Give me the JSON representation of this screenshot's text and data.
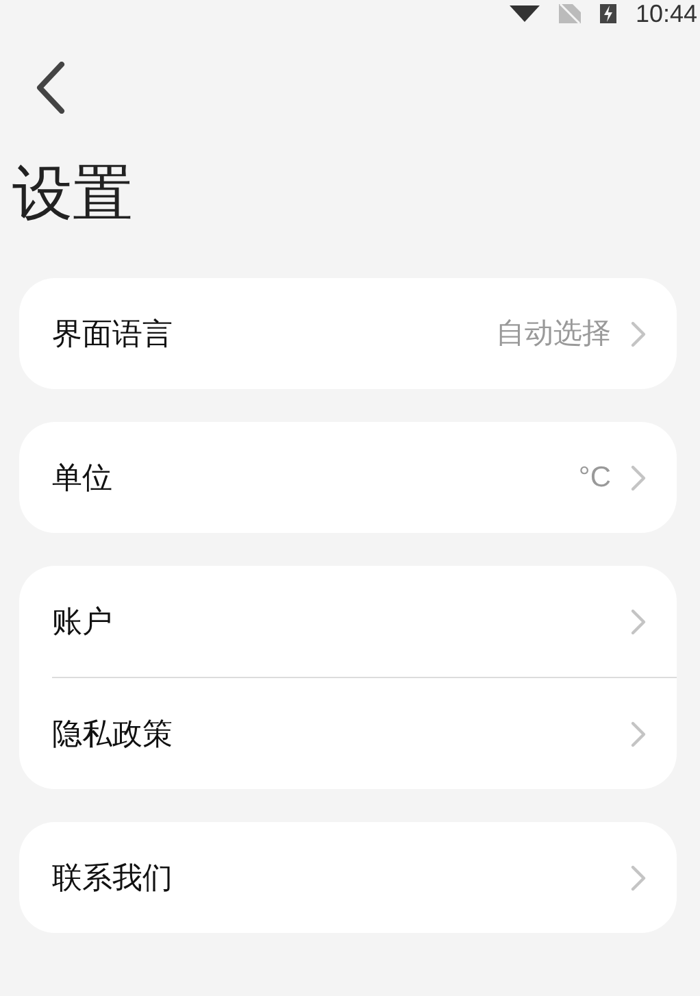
{
  "status_bar": {
    "time": "10:44"
  },
  "title": "设置",
  "groups": [
    {
      "items": [
        {
          "label": "界面语言",
          "value": "自动选择"
        }
      ]
    },
    {
      "items": [
        {
          "label": "单位",
          "value": "°C"
        }
      ]
    },
    {
      "items": [
        {
          "label": "账户"
        },
        {
          "label": "隐私政策"
        }
      ]
    },
    {
      "items": [
        {
          "label": "联系我们"
        }
      ]
    }
  ]
}
